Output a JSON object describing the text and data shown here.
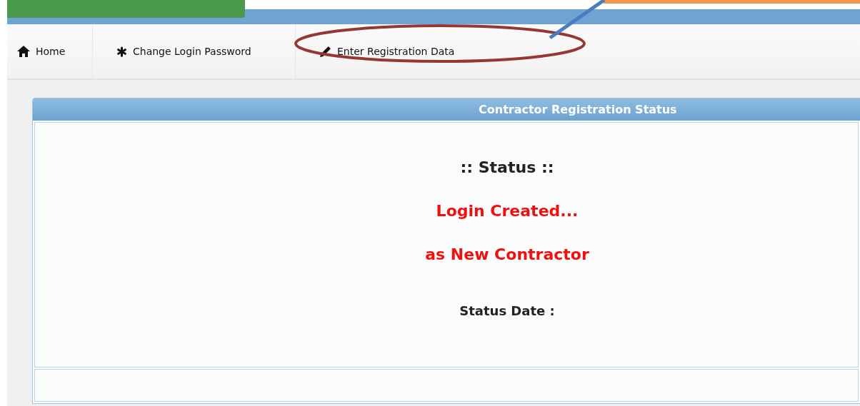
{
  "nav": [
    {
      "label": "Home"
    },
    {
      "label": "Change Login Password"
    },
    {
      "label": "Enter Registration Data"
    }
  ],
  "panel": {
    "title": "Contractor Registration Status",
    "heading": ":: Status ::",
    "messages": [
      "Login Created...",
      "as New Contractor"
    ],
    "date_label": "Status Date :"
  }
}
